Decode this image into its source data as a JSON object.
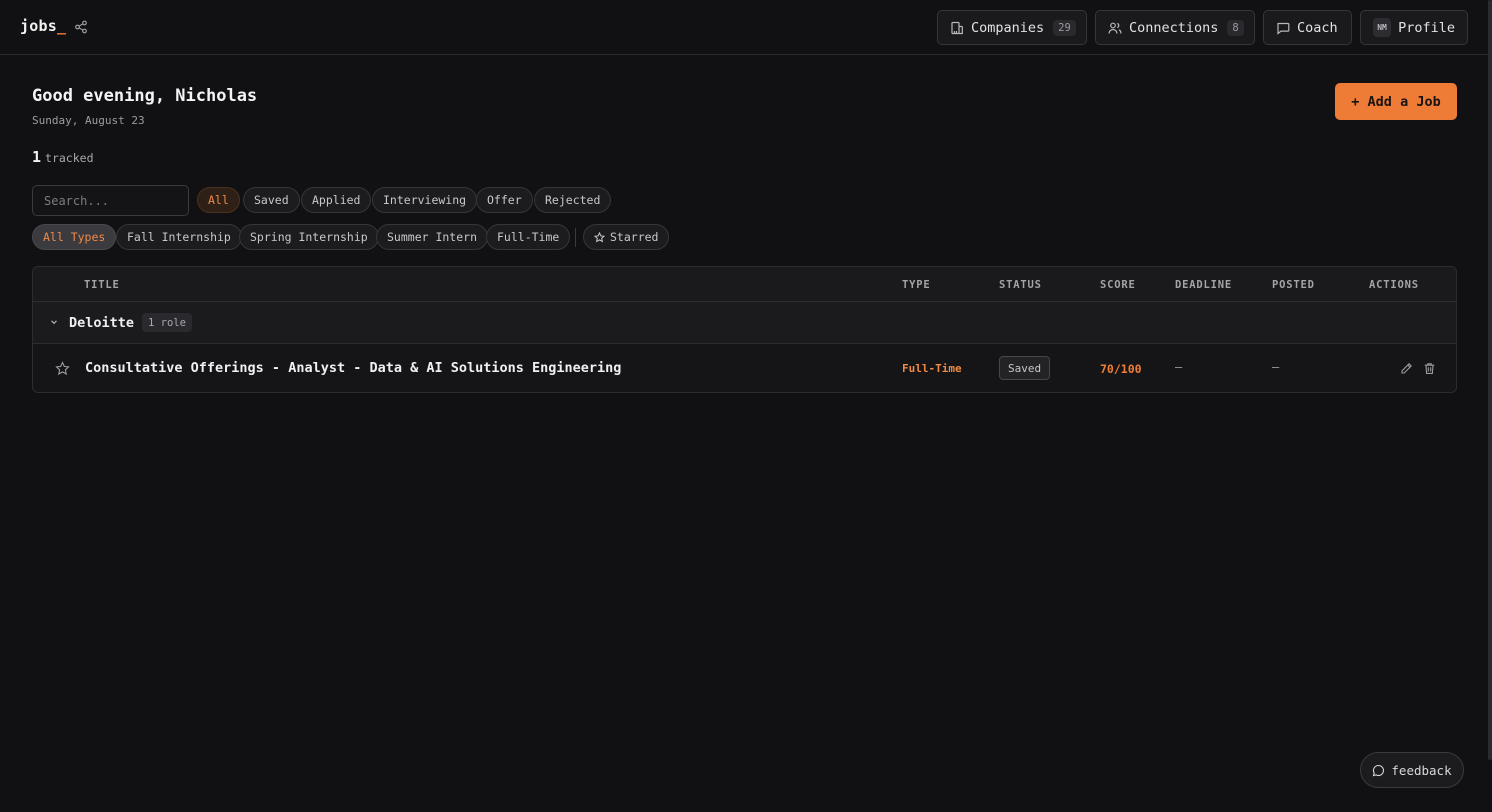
{
  "brand": {
    "name": "jobs",
    "cursor": "_"
  },
  "nav": {
    "companies": {
      "label": "Companies",
      "count": "29",
      "icon": "building-icon"
    },
    "connections": {
      "label": "Connections",
      "count": "8",
      "icon": "users-icon"
    },
    "coach": {
      "label": "Coach",
      "icon": "chat-icon"
    },
    "profile": {
      "label": "Profile",
      "initials": "NM"
    }
  },
  "header": {
    "greeting": "Good evening, Nicholas",
    "date": "Sunday, August 23",
    "add_job": "+ Add a Job",
    "tracked_count": "1",
    "tracked_label": "tracked"
  },
  "search": {
    "placeholder": "Search...",
    "value": ""
  },
  "status_filters": [
    "All",
    "Saved",
    "Applied",
    "Interviewing",
    "Offer",
    "Rejected"
  ],
  "active_status": "All",
  "type_filters": [
    "All Types",
    "Fall Internship",
    "Spring Internship",
    "Summer Intern",
    "Full-Time"
  ],
  "active_type": "All Types",
  "starred_label": "Starred",
  "table": {
    "columns": {
      "title": "TITLE",
      "type": "TYPE",
      "status": "STATUS",
      "score": "SCORE",
      "deadline": "DEADLINE",
      "posted": "POSTED",
      "actions": "ACTIONS"
    },
    "groups": [
      {
        "company": "Deloitte",
        "role_count": "1 role",
        "jobs": [
          {
            "title": "Consultative Offerings - Analyst - Data & AI Solutions Engineering",
            "type": "Full-Time",
            "status": "Saved",
            "score": "70/100",
            "deadline": "—",
            "posted": "—",
            "starred": false
          }
        ]
      }
    ]
  },
  "feedback": {
    "label": "feedback"
  },
  "colors": {
    "accent": "#ee7c37",
    "background": "#111113",
    "surface": "#151518"
  }
}
